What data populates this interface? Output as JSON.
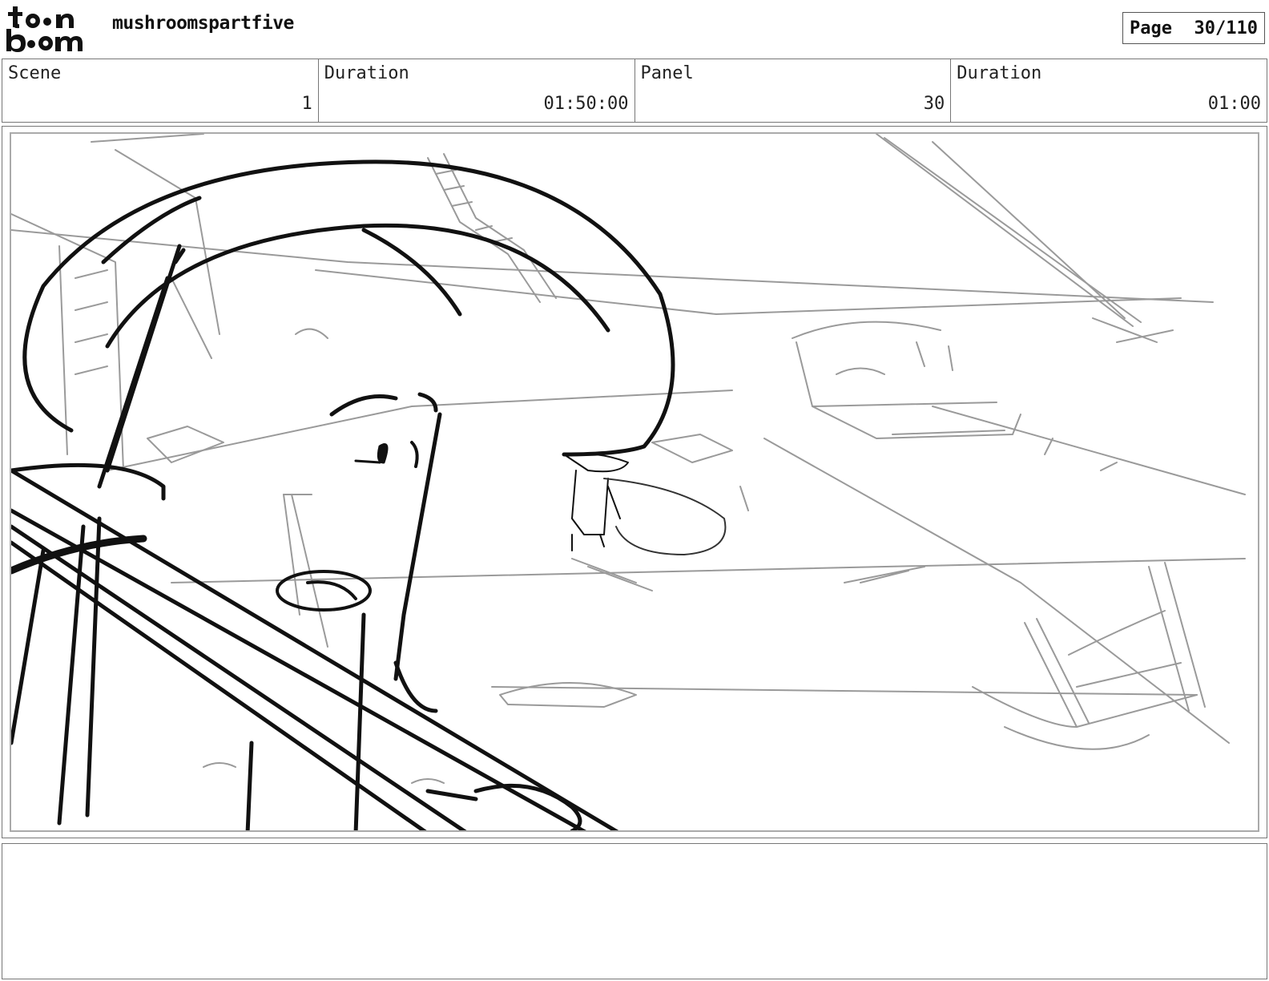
{
  "header": {
    "logo_text": "toon boom",
    "project_title": "mushroomspartfive",
    "page_label": "Page",
    "page_value": "30/110"
  },
  "info": {
    "scene_label": "Scene",
    "scene_value": "1",
    "scene_duration_label": "Duration",
    "scene_duration_value": "01:50:00",
    "panel_label": "Panel",
    "panel_value": "30",
    "panel_duration_label": "Duration",
    "panel_duration_value": "01:00"
  },
  "colors": {
    "ink": "#111111",
    "rough": "#9a9a9a",
    "frame": "#777777"
  }
}
